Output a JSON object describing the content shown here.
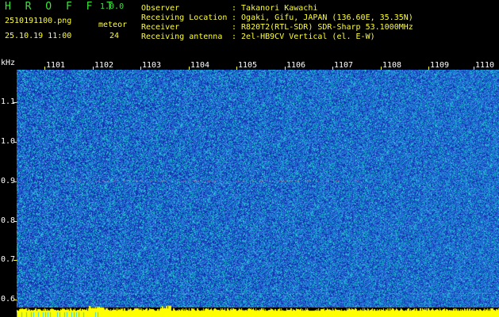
{
  "app": {
    "title": "H R O F F T",
    "version": "1.0.0"
  },
  "file": {
    "name": "2510191100.png",
    "datetime": "25.10.19 11:00"
  },
  "meteor": {
    "label": "meteor",
    "count": "24"
  },
  "info": [
    {
      "key": "Observer",
      "value": ": Takanori Kawachi"
    },
    {
      "key": "Receiving Location",
      "value": ": Ogaki, Gifu, JAPAN (136.60E, 35.35N)"
    },
    {
      "key": "Receiver",
      "value": ": R820T2(RTL-SDR) SDR-Sharp 53.1000MHz"
    },
    {
      "key": "Receiving antenna",
      "value": ": 2el-HB9CV Vertical (el. E-W)"
    }
  ],
  "axes": {
    "y_unit": "kHz",
    "x_ticks": [
      "1101",
      "1102",
      "1103",
      "1104",
      "1105",
      "1106",
      "1107",
      "1108",
      "1109",
      "1110"
    ],
    "y_ticks": [
      "1.1",
      "1.0",
      "0.9",
      "0.8",
      "0.7",
      "0.6"
    ]
  },
  "colors": {
    "background": "#000000",
    "header_text": "#ffff33",
    "title_text": "#39e639",
    "tick_text": "#ffffff",
    "spectrum_low": "#1f5fc8",
    "spectrum_high": "#2ad0d0",
    "signal_trace": "#ff7070",
    "power_bar": "#ffff00"
  }
}
